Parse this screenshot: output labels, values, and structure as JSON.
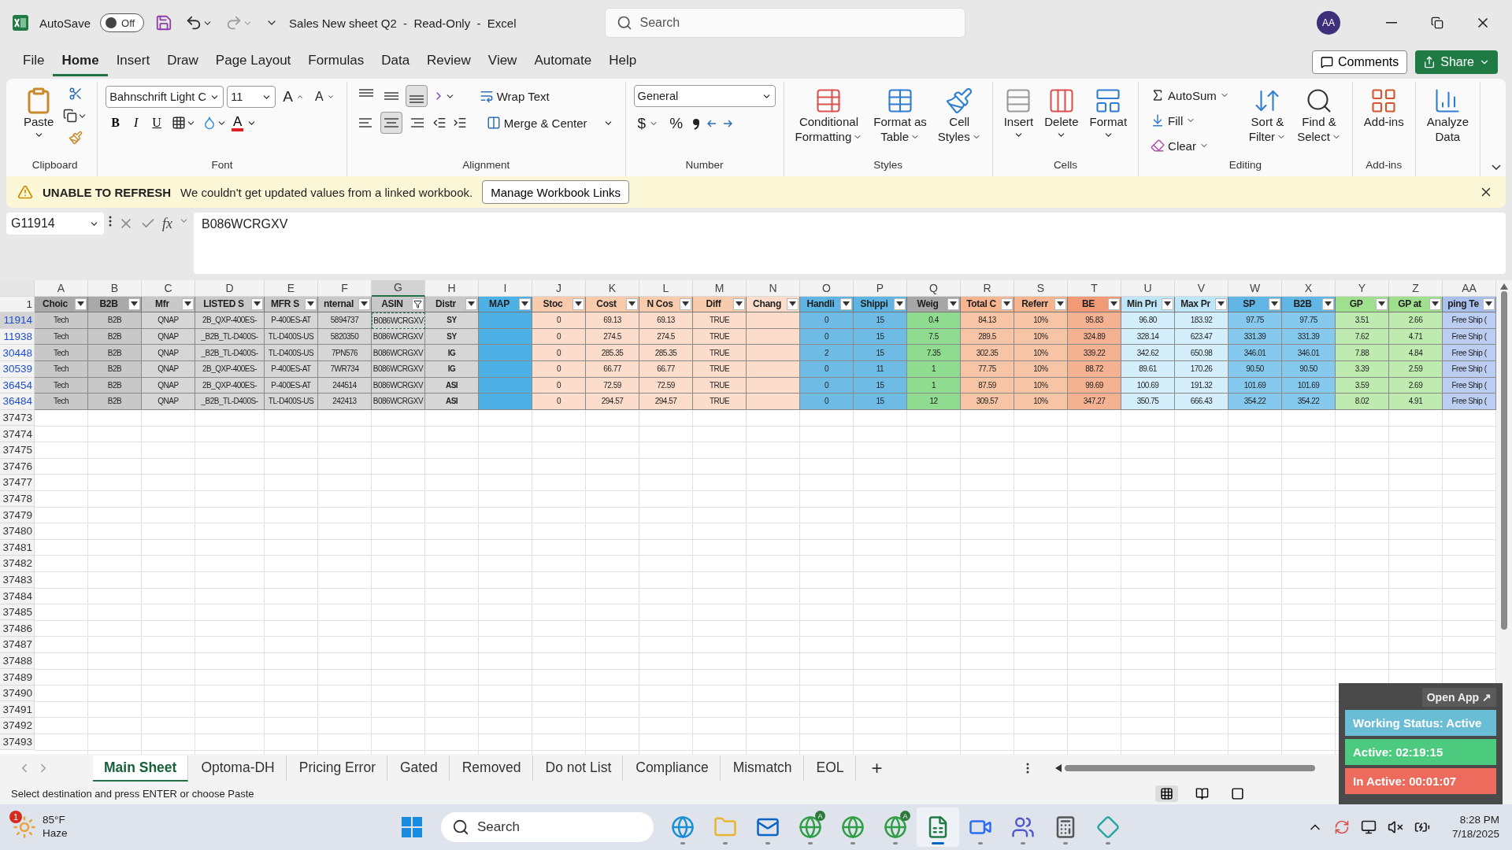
{
  "title_bar": {
    "autosave_label": "AutoSave",
    "autosave": {
      "on": false,
      "label": "Off"
    },
    "title": "Sales New sheet Q2  -  Read-Only  -  Excel",
    "search": {
      "placeholder": "Search"
    },
    "avatar": "AA"
  },
  "menu_tabs": [
    {
      "label": "File",
      "selected": false
    },
    {
      "label": "Home",
      "selected": true
    },
    {
      "label": "Insert",
      "selected": false
    },
    {
      "label": "Draw",
      "selected": false
    },
    {
      "label": "Page Layout",
      "selected": false
    },
    {
      "label": "Formulas",
      "selected": false
    },
    {
      "label": "Data",
      "selected": false
    },
    {
      "label": "Review",
      "selected": false
    },
    {
      "label": "View",
      "selected": false
    },
    {
      "label": "Automate",
      "selected": false
    },
    {
      "label": "Help",
      "selected": false
    }
  ],
  "header_buttons": {
    "comments": "Comments",
    "share": "Share"
  },
  "ribbon": {
    "clipboard": {
      "label": "Clipboard",
      "paste": "Paste"
    },
    "font": {
      "label": "Font",
      "name": "Bahnschrift Light C",
      "size": "11",
      "grow": "A",
      "shrink": "A",
      "styles": [
        {
          "kind": "bold",
          "label": "B"
        },
        {
          "kind": "italic",
          "label": "I"
        },
        {
          "kind": "underline",
          "label": "U"
        }
      ],
      "font_color": "A"
    },
    "alignment": {
      "label": "Alignment",
      "vertical": [
        {
          "kind": "top",
          "selected": false
        },
        {
          "kind": "middle",
          "selected": false
        },
        {
          "kind": "bottom",
          "selected": true
        }
      ],
      "horizontal": [
        {
          "kind": "left",
          "selected": false
        },
        {
          "kind": "center",
          "selected": true
        },
        {
          "kind": "right",
          "selected": false
        }
      ],
      "wrap": "Wrap Text",
      "merge": "Merge & Center"
    },
    "number": {
      "label": "Number",
      "format": "General",
      "currency": "$",
      "percent": "%"
    },
    "groups": [
      {
        "label": "Styles",
        "buttons": [
          {
            "kind": "conditional",
            "lines": [
              "Conditional",
              "Formatting"
            ],
            "menu": true
          },
          {
            "kind": "table",
            "lines": [
              "Format as",
              "Table"
            ],
            "menu": true
          },
          {
            "kind": "cell_styles",
            "lines": [
              "Cell",
              "Styles"
            ],
            "menu": true
          }
        ]
      },
      {
        "label": "Cells",
        "buttons": [
          {
            "kind": "insert",
            "lines": [
              "Insert"
            ],
            "menu": true
          },
          {
            "kind": "delete",
            "lines": [
              "Delete"
            ],
            "menu": true
          },
          {
            "kind": "format",
            "lines": [
              "Format"
            ],
            "menu": true
          }
        ]
      },
      {
        "label": "Editing",
        "small": [
          {
            "kind": "autosum",
            "label": "AutoSum"
          },
          {
            "kind": "fill",
            "label": "Fill"
          },
          {
            "kind": "clear",
            "label": "Clear"
          }
        ],
        "buttons": [
          {
            "kind": "sort",
            "lines": [
              "Sort &",
              "Filter"
            ],
            "menu": true
          },
          {
            "kind": "find",
            "lines": [
              "Find &",
              "Select"
            ],
            "menu": true
          }
        ]
      },
      {
        "label": "Add-ins",
        "buttons": [
          {
            "kind": "addins",
            "lines": [
              "Add-ins"
            ],
            "menu": false
          }
        ]
      },
      {
        "buttons": [
          {
            "kind": "analyze",
            "lines": [
              "Analyze",
              "Data"
            ],
            "menu": false
          }
        ]
      }
    ]
  },
  "info_bar": {
    "title": "UNABLE TO REFRESH",
    "message": "We couldn't get updated values from a linked workbook.",
    "button": "Manage Workbook Links"
  },
  "formula_bar": {
    "name_box": "G11914",
    "fx": "fx",
    "value": "B086WCRGXV"
  },
  "sheet": {
    "header_row": "1",
    "columns": [
      {
        "letter": "A",
        "header": "Choic",
        "color": "#a9a9a9",
        "body": {
          "color": "#c8c8c8"
        },
        "kind": "plain",
        "filtered": false,
        "selected": false
      },
      {
        "letter": "B",
        "header": "B2B",
        "color": "#a9a9a9",
        "body": {
          "color": "#c8c8c8"
        },
        "kind": "plain",
        "filtered": false,
        "selected": false
      },
      {
        "letter": "C",
        "header": "Mfr",
        "color": "#c8c8c8",
        "body": {
          "color": "#d6d6d6"
        },
        "kind": "plain",
        "filtered": false,
        "selected": false
      },
      {
        "letter": "D",
        "header": "LISTED S",
        "color": "#c8c8c8",
        "body": {
          "color": "#d6d6d6"
        },
        "kind": "plain",
        "filtered": false,
        "selected": false
      },
      {
        "letter": "E",
        "header": "MFR S",
        "color": "#c8c8c8",
        "body": {
          "color": "#d6d6d6"
        },
        "kind": "plain",
        "filtered": false,
        "selected": false
      },
      {
        "letter": "F",
        "header": "nternal",
        "color": "#c8c8c8",
        "body": {
          "color": "#d6d6d6"
        },
        "kind": "plain",
        "filtered": false,
        "selected": false
      },
      {
        "letter": "G",
        "header": "ASIN",
        "color": "#c8c8c8",
        "body": {
          "color": "#d6d6d6"
        },
        "kind": "plain",
        "filtered": true,
        "selected": true
      },
      {
        "letter": "H",
        "header": "Distr",
        "color": "#c8c8c8",
        "body": {
          "color": "#d6d6d6"
        },
        "kind": "bold",
        "filtered": false,
        "selected": false
      },
      {
        "letter": "I",
        "header": "MAP",
        "color": "#4eb1e6",
        "body": {
          "color": "#4eb1e6"
        },
        "kind": "plain",
        "filtered": false,
        "selected": false
      },
      {
        "letter": "J",
        "header": "Stoc",
        "color": "#f8cbad",
        "body": {
          "color": "#fcdccb"
        },
        "kind": "plain",
        "filtered": false,
        "selected": false
      },
      {
        "letter": "K",
        "header": "Cost",
        "color": "#f8cbad",
        "body": {
          "color": "#fcdccb"
        },
        "kind": "plain",
        "filtered": false,
        "selected": false
      },
      {
        "letter": "L",
        "header": "N Cos",
        "color": "#f8cbad",
        "body": {
          "color": "#fcdccb"
        },
        "kind": "plain",
        "filtered": false,
        "selected": false
      },
      {
        "letter": "M",
        "header": "Diff",
        "color": "#f8cbad",
        "body": {
          "color": "#fcdccb"
        },
        "kind": "plain",
        "filtered": false,
        "selected": false
      },
      {
        "letter": "N",
        "header": "Chang",
        "color": "#fcdccb",
        "body": {
          "color": "#fcdccb"
        },
        "kind": "plain",
        "filtered": false,
        "selected": false
      },
      {
        "letter": "O",
        "header": "Handli",
        "color": "#5eb4e2",
        "body": {
          "color": "#6ebce6"
        },
        "kind": "plain",
        "filtered": false,
        "selected": false
      },
      {
        "letter": "P",
        "header": "Shippi",
        "color": "#5eb4e2",
        "body": {
          "color": "#6ebce6"
        },
        "kind": "plain",
        "filtered": false,
        "selected": false
      },
      {
        "letter": "Q",
        "header": "Weig",
        "color": "#a6a6a6",
        "body": {
          "color": "#8fdb8f"
        },
        "kind": "plain",
        "filtered": false,
        "selected": false
      },
      {
        "letter": "R",
        "header": "Total C",
        "color": "#f6b48f",
        "body": {
          "color": "#f8c4a6"
        },
        "kind": "plain",
        "filtered": false,
        "selected": false
      },
      {
        "letter": "S",
        "header": "Referr",
        "color": "#f6b48f",
        "body": {
          "color": "#f8c4a6"
        },
        "kind": "plain",
        "filtered": false,
        "selected": false
      },
      {
        "letter": "T",
        "header": "BE",
        "color": "#f29a76",
        "body": {
          "color": "#f5b292"
        },
        "kind": "plain",
        "filtered": false,
        "selected": false
      },
      {
        "letter": "U",
        "header": "Min Pri",
        "color": "#bfe6f8",
        "body": {
          "color": "#d4effb"
        },
        "kind": "plain",
        "filtered": false,
        "selected": false
      },
      {
        "letter": "V",
        "header": "Max Pr",
        "color": "#bfe6f8",
        "body": {
          "color": "#d4effb"
        },
        "kind": "plain",
        "filtered": false,
        "selected": false
      },
      {
        "letter": "W",
        "header": "SP",
        "color": "#62b6e6",
        "body": {
          "color": "#86c9ee"
        },
        "kind": "plain",
        "filtered": false,
        "selected": false
      },
      {
        "letter": "X",
        "header": "B2B",
        "color": "#62b6e6",
        "body": {
          "color": "#86c9ee"
        },
        "kind": "plain",
        "filtered": false,
        "selected": false
      },
      {
        "letter": "Y",
        "header": "GP",
        "color": "#9fdf8e",
        "body": {
          "color": "#bfebb1"
        },
        "kind": "plain",
        "filtered": false,
        "selected": false
      },
      {
        "letter": "Z",
        "header": "GP at",
        "color": "#9fdf8e",
        "body": {
          "color": "#bfebb1"
        },
        "kind": "plain",
        "filtered": false,
        "selected": false
      },
      {
        "letter": "AA",
        "header": "ping Te",
        "color": "#a9bfee",
        "body": {
          "color": "#bccdf2"
        },
        "kind": "plain",
        "filtered": false,
        "selected": false
      }
    ],
    "rows": [
      {
        "number": "11914",
        "selected": true,
        "cells": [
          "Tech",
          "B2B",
          "QNAP",
          "2B_QXP-400ES-",
          "P-400ES-AT",
          "5894737",
          "B086WCRGXV",
          "SY",
          "",
          "0",
          "69.13",
          "69.13",
          "TRUE",
          "",
          "0",
          "15",
          "0.4",
          "84.13",
          "10%",
          "95.83",
          "96.80",
          "183.92",
          "97.75",
          "97.75",
          "3.51",
          "2.66",
          "Free Ship ("
        ]
      },
      {
        "number": "11938",
        "selected": false,
        "cells": [
          "Tech",
          "B2B",
          "QNAP",
          "_B2B_TL-D400S-",
          "TL-D400S-US",
          "5820350",
          "B086WCRGXV",
          "SY",
          "",
          "0",
          "274.5",
          "274.5",
          "TRUE",
          "",
          "0",
          "15",
          "7.5",
          "289.5",
          "10%",
          "324.89",
          "328.14",
          "623.47",
          "331.39",
          "331.39",
          "7.62",
          "4.71",
          "Free Ship ("
        ]
      },
      {
        "number": "30448",
        "selected": false,
        "cells": [
          "Tech",
          "B2B",
          "QNAP",
          "_B2B_TL-D400S-",
          "TL-D400S-US",
          "7PN576",
          "B086WCRGXV",
          "IG",
          "",
          "0",
          "285.35",
          "285.35",
          "TRUE",
          "",
          "2",
          "15",
          "7.35",
          "302.35",
          "10%",
          "339.22",
          "342.62",
          "650.98",
          "346.01",
          "346.01",
          "7.88",
          "4.84",
          "Free Ship ("
        ]
      },
      {
        "number": "30539",
        "selected": false,
        "cells": [
          "Tech",
          "B2B",
          "QNAP",
          "2B_QXP-400ES-",
          "P-400ES-AT",
          "7WR734",
          "B086WCRGXV",
          "IG",
          "",
          "0",
          "66.77",
          "66.77",
          "TRUE",
          "",
          "0",
          "11",
          "1",
          "77.75",
          "10%",
          "88.72",
          "89.61",
          "170.26",
          "90.50",
          "90.50",
          "3.39",
          "2.59",
          "Free Ship ("
        ]
      },
      {
        "number": "36454",
        "selected": false,
        "cells": [
          "Tech",
          "B2B",
          "QNAP",
          "2B_QXP-400ES-",
          "P-400ES-AT",
          "244514",
          "B086WCRGXV",
          "ASI",
          "",
          "0",
          "72.59",
          "72.59",
          "TRUE",
          "",
          "0",
          "15",
          "1",
          "87.59",
          "10%",
          "99.69",
          "100.69",
          "191.32",
          "101.69",
          "101.69",
          "3.59",
          "2.69",
          "Free Ship ("
        ]
      },
      {
        "number": "36484",
        "selected": false,
        "cells": [
          "Tech",
          "B2B",
          "QNAP",
          "_B2B_TL-D400S-",
          "TL-D400S-US",
          "242413",
          "B086WCRGXV",
          "ASI",
          "",
          "0",
          "294.57",
          "294.57",
          "TRUE",
          "",
          "0",
          "15",
          "12",
          "309.57",
          "10%",
          "347.27",
          "350.75",
          "666.43",
          "354.22",
          "354.22",
          "8.02",
          "4.91",
          "Free Ship ("
        ]
      }
    ],
    "empty_rows": [
      "37473",
      "37474",
      "37475",
      "37476",
      "37477",
      "37478",
      "37479",
      "37480",
      "37481",
      "37482",
      "37483",
      "37484",
      "37485",
      "37486",
      "37487",
      "37488",
      "37489",
      "37490",
      "37491",
      "37492",
      "37493"
    ]
  },
  "sheet_tabs": [
    {
      "label": "Main Sheet",
      "selected": true
    },
    {
      "label": "Optoma-DH",
      "selected": false
    },
    {
      "label": "Pricing Error",
      "selected": false
    },
    {
      "label": "Gated",
      "selected": false
    },
    {
      "label": "Removed",
      "selected": false
    },
    {
      "label": "Do not List",
      "selected": false
    },
    {
      "label": "Compliance",
      "selected": false
    },
    {
      "label": "Mismatch",
      "selected": false
    },
    {
      "label": "EOL",
      "selected": false
    }
  ],
  "add_sheet": "+",
  "status_bar": {
    "message": "Select destination and press ENTER or choose Paste",
    "views": [
      {
        "kind": "normal",
        "selected": true
      },
      {
        "kind": "page_layout",
        "selected": false
      },
      {
        "kind": "page_break",
        "selected": false
      }
    ]
  },
  "tracker": {
    "open_app": "Open App ↗",
    "status": "Working Status: Active",
    "active": "Active: 02:19:15",
    "inactive": "In Active: 00:01:07"
  },
  "taskbar": {
    "weather": {
      "badge": "1",
      "temp": "85°F",
      "condition": "Haze"
    },
    "search": {
      "placeholder": "Search"
    },
    "apps": [
      {
        "kind": "edge",
        "active": false
      },
      {
        "kind": "folder",
        "active": false
      },
      {
        "kind": "mail",
        "active": false
      },
      {
        "kind": "chrome",
        "badge": "A",
        "active": false
      },
      {
        "kind": "chrome",
        "active": false
      },
      {
        "kind": "chrome",
        "badge": "A",
        "active": false
      },
      {
        "kind": "excel",
        "active": true
      },
      {
        "kind": "zoom",
        "active": false
      },
      {
        "kind": "teams",
        "active": false
      },
      {
        "kind": "calculator",
        "active": false
      },
      {
        "kind": "diamond",
        "active": false
      }
    ],
    "time": "8:28 PM",
    "date": "7/18/2025"
  }
}
